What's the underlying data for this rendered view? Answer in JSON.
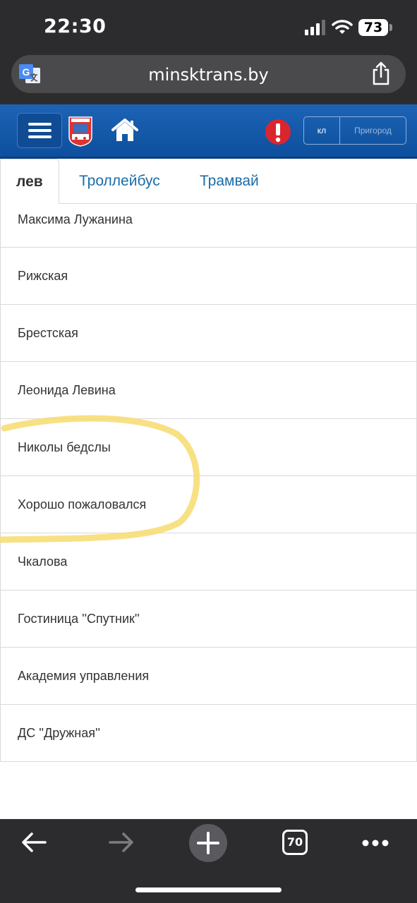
{
  "status_bar": {
    "time": "22:30",
    "battery": "73"
  },
  "browser": {
    "url": "minsktrans.by",
    "tab_count": "70"
  },
  "header": {
    "region_city": "кл",
    "region_suburb": "Пригород"
  },
  "tabs": [
    {
      "label": "лев"
    },
    {
      "label": "Троллейбус"
    },
    {
      "label": "Трамвай"
    }
  ],
  "stops": [
    "Максима Лужанина",
    "Рижская",
    "Брестская",
    "Леонида Левина",
    "Николы бедслы",
    "Хорошо пожаловался",
    "Чкалова",
    "Гостиница ''Спутник''",
    "Академия управления",
    "ДС ''Дружная''"
  ],
  "colors": {
    "header_blue": "#1d63b5",
    "link_blue": "#1a6ca8",
    "highlight_yellow": "#f7dc6f",
    "alert_red": "#d9262e"
  }
}
